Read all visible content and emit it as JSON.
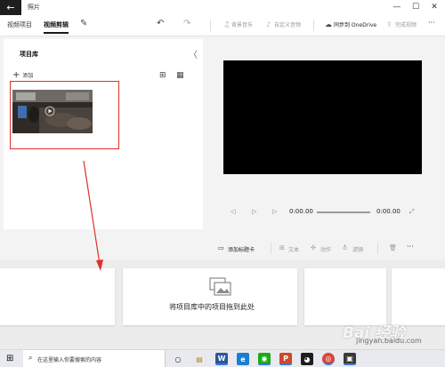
{
  "titlebar": {
    "app_title": "照片",
    "back_glyph": "←",
    "min_glyph": "—",
    "max_glyph": "☐",
    "close_glyph": "✕"
  },
  "toolbar": {
    "tabs": [
      {
        "label": "视频项目",
        "active": false
      },
      {
        "label": "视频剪辑",
        "active": true
      }
    ],
    "edit_glyph": "✎",
    "undo_glyph": "↶",
    "redo_glyph": "↷",
    "background_music": "背景音乐",
    "custom_audio": "自定义音频",
    "sync_onedrive": "同步到 OneDrive",
    "finish_video": "完成视频",
    "more": "···"
  },
  "library": {
    "title": "项目库",
    "add_label": "添加",
    "collapse_glyph": "〈",
    "grid_view_glyph": "⊞",
    "list_view_glyph": "▦",
    "play_glyph": "▶"
  },
  "preview": {
    "current_time": "0:00.00",
    "total_time": "0:00.00",
    "rewind_glyph": "◁",
    "play_glyph": "▷",
    "forward_glyph": "▷",
    "fullscreen_glyph": "⤢"
  },
  "storyboard": {
    "add_title_card": "添加标题卡",
    "text": "文本",
    "motion": "动作",
    "filters": "滤镜",
    "delete_glyph": "🗑",
    "more": "···",
    "drop_hint": "将项目库中的项目拖到此处"
  },
  "taskbar": {
    "search_placeholder": "在这里输入你要搜索的内容",
    "apps": [
      {
        "name": "task-view",
        "label": "○",
        "color": "#e8eaef",
        "text_color": "#222"
      },
      {
        "name": "explorer",
        "label": "▤",
        "color": "#e8eaef",
        "text_color": "#333"
      },
      {
        "name": "word",
        "label": "W",
        "color": "#2b579a",
        "text_color": "#fff"
      },
      {
        "name": "edge",
        "label": "e",
        "color": "#1b7fd1",
        "text_color": "#fff"
      },
      {
        "name": "wechat",
        "label": "◉",
        "color": "#1aad19",
        "text_color": "#fff"
      },
      {
        "name": "powerpoint",
        "label": "P",
        "color": "#d24726",
        "text_color": "#fff"
      },
      {
        "name": "qq",
        "label": "◕",
        "color": "#1e1e1e",
        "text_color": "#fff"
      },
      {
        "name": "chrome",
        "label": "◎",
        "color": "#db4437",
        "text_color": "#fff"
      },
      {
        "name": "photos",
        "label": "▣",
        "color": "#3a3a3a",
        "text_color": "#fff"
      }
    ]
  },
  "watermark": {
    "logo": "Bai 经验",
    "url": "jingyan.baidu.com"
  },
  "colors": {
    "highlight_box": "#e0302a",
    "arrow": "#e0302a"
  }
}
